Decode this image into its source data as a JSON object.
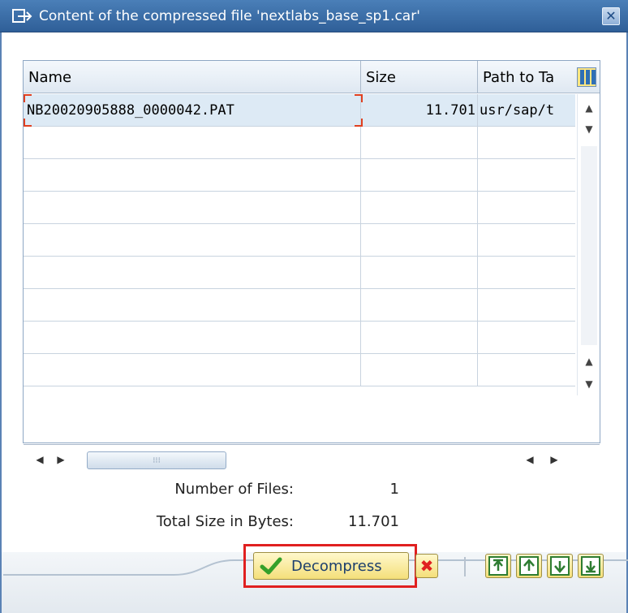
{
  "dialog": {
    "title": "Content of the compressed file 'nextlabs_base_sp1.car'",
    "close_glyph": "✕"
  },
  "table": {
    "columns": [
      {
        "label": "Name"
      },
      {
        "label": "Size"
      },
      {
        "label": "Path to Ta"
      }
    ],
    "rows": [
      {
        "name": "NB20020905888_0000042.PAT",
        "size": "11.701",
        "path": "usr/sap/t"
      }
    ],
    "empty_rows": 8,
    "selected_row": 0
  },
  "summary": {
    "files_label": "Number of Files:",
    "files_value": "1",
    "size_label": "Total Size in Bytes:",
    "size_value": "11.701"
  },
  "toolbar": {
    "decompress_label": "Decompress",
    "decompress_icon": "check-icon",
    "cancel_icon": "cancel-icon",
    "nav_icons": [
      "first-page-icon",
      "previous-page-icon",
      "next-page-icon",
      "last-page-icon"
    ]
  },
  "colors": {
    "titlebar": "#3a6da8",
    "highlight_outline": "#e02020",
    "button_bg": "#f7e79a",
    "selected_row": "#ddeaf5"
  }
}
